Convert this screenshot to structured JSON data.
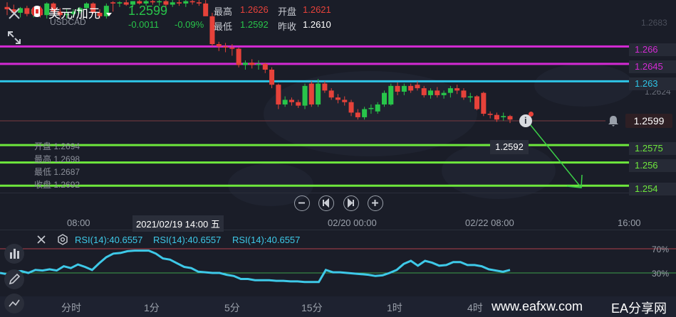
{
  "header": {
    "symbol_name": "美元/加元",
    "symbol_code": "USDCAD",
    "last_price": "1.2599",
    "change": "-0.0011",
    "change_pct": "-0.09%",
    "high_label": "最高",
    "high_value": "1.2626",
    "open_label": "开盘",
    "open_value": "1.2621",
    "low_label": "最低",
    "low_value": "1.2592",
    "prev_close_label": "昨收",
    "prev_close_value": "1.2610"
  },
  "ohlc_box": {
    "open": "开盘 1.2694",
    "high": "最高 1.2698",
    "low": "最低 1.2687",
    "close": "收盘 1.2692"
  },
  "levels": [
    {
      "price": 1.266,
      "label": "1.266",
      "color": "#d42ad4"
    },
    {
      "price": 1.2645,
      "label": "1.2645",
      "color": "#d42ad4"
    },
    {
      "price": 1.263,
      "label": "1.263",
      "color": "#2ec4e6"
    },
    {
      "price": 1.2575,
      "label": "1.2575",
      "color": "#6ee83c"
    },
    {
      "price": 1.256,
      "label": "1.256",
      "color": "#6ee83c"
    },
    {
      "price": 1.254,
      "label": "1.254",
      "color": "#6ee83c"
    }
  ],
  "current_price_label": "1.2599",
  "price_scale_ticks": [
    "1.2683",
    "1.2624"
  ],
  "tooltip_price": "1.2592",
  "time_axis": [
    "08:00",
    "2021/02/19 14:00 五",
    "02/20 00:00",
    "02/22 08:00",
    "16:00"
  ],
  "rsi": {
    "legend": [
      "RSI(14):40.6557",
      "RSI(14):40.6557",
      "RSI(14):40.6557"
    ],
    "upper_label": "70%",
    "lower_label": "30%",
    "values": [
      30,
      28,
      32,
      33,
      30,
      35,
      34,
      36,
      34,
      41,
      38,
      44,
      40,
      35,
      46,
      56,
      62,
      63,
      66,
      67,
      67,
      67,
      62,
      54,
      52,
      46,
      40,
      38,
      32,
      31,
      30,
      30,
      27,
      25,
      20,
      20,
      18,
      18,
      18,
      17,
      17,
      16,
      16,
      15,
      15,
      15,
      35,
      31,
      31,
      30,
      29,
      28,
      27,
      25,
      26,
      30,
      35,
      45,
      50,
      42,
      50,
      47,
      42,
      43,
      48,
      48,
      43,
      43,
      41,
      36,
      34,
      32,
      35
    ]
  },
  "periods": [
    "分时",
    "1分",
    "5分",
    "15分",
    "1时",
    "4时"
  ],
  "watermark": "www.eafxw.com",
  "brand": "EA分享网",
  "colors": {
    "up": "#28c44a",
    "down": "#e6423a",
    "rsi": "#3ec9e8",
    "background": "#1a1d28"
  },
  "icons": [
    "close-icon",
    "canada-flag-icon",
    "dropdown-icon",
    "expand-icon",
    "bell-icon",
    "info-icon",
    "zoom-out-icon",
    "prev-icon",
    "next-icon",
    "zoom-in-icon",
    "settings-icon",
    "indicators-icon",
    "draw-icon",
    "chart-type-icon"
  ],
  "chart_data": {
    "type": "candlestick",
    "candles": [
      {
        "o": 1.2694,
        "h": 1.2698,
        "l": 1.2687,
        "c": 1.2692
      },
      {
        "o": 1.2692,
        "h": 1.2696,
        "l": 1.2687,
        "c": 1.2689
      },
      {
        "o": 1.2689,
        "h": 1.2694,
        "l": 1.2685,
        "c": 1.2693
      },
      {
        "o": 1.2693,
        "h": 1.2695,
        "l": 1.2686,
        "c": 1.2688
      },
      {
        "o": 1.2688,
        "h": 1.2694,
        "l": 1.2685,
        "c": 1.2692
      },
      {
        "o": 1.2692,
        "h": 1.2695,
        "l": 1.2685,
        "c": 1.2687
      },
      {
        "o": 1.2687,
        "h": 1.2698,
        "l": 1.2684,
        "c": 1.2697
      },
      {
        "o": 1.2697,
        "h": 1.2698,
        "l": 1.2688,
        "c": 1.269
      },
      {
        "o": 1.269,
        "h": 1.2693,
        "l": 1.2685,
        "c": 1.2687
      },
      {
        "o": 1.2687,
        "h": 1.2692,
        "l": 1.2684,
        "c": 1.2688
      },
      {
        "o": 1.2688,
        "h": 1.2692,
        "l": 1.2685,
        "c": 1.269
      },
      {
        "o": 1.269,
        "h": 1.2694,
        "l": 1.2688,
        "c": 1.2693
      },
      {
        "o": 1.2693,
        "h": 1.2698,
        "l": 1.2687,
        "c": 1.2697
      },
      {
        "o": 1.2697,
        "h": 1.2698,
        "l": 1.2688,
        "c": 1.2689
      },
      {
        "o": 1.2689,
        "h": 1.2692,
        "l": 1.2684,
        "c": 1.2686
      },
      {
        "o": 1.2686,
        "h": 1.2697,
        "l": 1.2684,
        "c": 1.2695
      },
      {
        "o": 1.2698,
        "h": 1.2699,
        "l": 1.269,
        "c": 1.2697
      },
      {
        "o": 1.2697,
        "h": 1.2699,
        "l": 1.2694,
        "c": 1.2698
      },
      {
        "o": 1.2698,
        "h": 1.27,
        "l": 1.2695,
        "c": 1.2696
      },
      {
        "o": 1.2696,
        "h": 1.2699,
        "l": 1.2694,
        "c": 1.2699
      },
      {
        "o": 1.2699,
        "h": 1.27,
        "l": 1.2696,
        "c": 1.2697
      },
      {
        "o": 1.2697,
        "h": 1.27,
        "l": 1.2695,
        "c": 1.2699
      },
      {
        "o": 1.2699,
        "h": 1.27,
        "l": 1.2696,
        "c": 1.2698
      },
      {
        "o": 1.2698,
        "h": 1.27,
        "l": 1.2695,
        "c": 1.2699
      },
      {
        "o": 1.2699,
        "h": 1.27,
        "l": 1.2694,
        "c": 1.2696
      },
      {
        "o": 1.2696,
        "h": 1.27,
        "l": 1.2694,
        "c": 1.2698
      },
      {
        "o": 1.2698,
        "h": 1.27,
        "l": 1.2695,
        "c": 1.2697
      },
      {
        "o": 1.2697,
        "h": 1.27,
        "l": 1.2694,
        "c": 1.2699
      },
      {
        "o": 1.2699,
        "h": 1.27,
        "l": 1.2696,
        "c": 1.2698
      },
      {
        "o": 1.2698,
        "h": 1.27,
        "l": 1.2695,
        "c": 1.2697
      },
      {
        "o": 1.2697,
        "h": 1.27,
        "l": 1.2693,
        "c": 1.2686
      },
      {
        "o": 1.2686,
        "h": 1.2689,
        "l": 1.266,
        "c": 1.2662
      },
      {
        "o": 1.2662,
        "h": 1.2664,
        "l": 1.2656,
        "c": 1.266
      },
      {
        "o": 1.266,
        "h": 1.2663,
        "l": 1.2655,
        "c": 1.2659
      },
      {
        "o": 1.2659,
        "h": 1.2662,
        "l": 1.2652,
        "c": 1.2658
      },
      {
        "o": 1.2658,
        "h": 1.2659,
        "l": 1.2642,
        "c": 1.2644
      },
      {
        "o": 1.2644,
        "h": 1.2648,
        "l": 1.264,
        "c": 1.2646
      },
      {
        "o": 1.2646,
        "h": 1.2649,
        "l": 1.2641,
        "c": 1.2644
      },
      {
        "o": 1.2644,
        "h": 1.2648,
        "l": 1.264,
        "c": 1.2645
      },
      {
        "o": 1.2645,
        "h": 1.2646,
        "l": 1.2637,
        "c": 1.264
      },
      {
        "o": 1.264,
        "h": 1.2642,
        "l": 1.2624,
        "c": 1.2627
      },
      {
        "o": 1.2627,
        "h": 1.2628,
        "l": 1.2606,
        "c": 1.261
      },
      {
        "o": 1.261,
        "h": 1.2617,
        "l": 1.2608,
        "c": 1.2614
      },
      {
        "o": 1.2614,
        "h": 1.2616,
        "l": 1.2609,
        "c": 1.2612
      },
      {
        "o": 1.2612,
        "h": 1.2614,
        "l": 1.2607,
        "c": 1.2609
      },
      {
        "o": 1.2609,
        "h": 1.2628,
        "l": 1.2606,
        "c": 1.2626
      },
      {
        "o": 1.2628,
        "h": 1.263,
        "l": 1.2608,
        "c": 1.261
      },
      {
        "o": 1.261,
        "h": 1.2632,
        "l": 1.2608,
        "c": 1.2628
      },
      {
        "o": 1.2628,
        "h": 1.263,
        "l": 1.262,
        "c": 1.2622
      },
      {
        "o": 1.2622,
        "h": 1.2624,
        "l": 1.2614,
        "c": 1.2616
      },
      {
        "o": 1.2616,
        "h": 1.2619,
        "l": 1.2611,
        "c": 1.2614
      },
      {
        "o": 1.2614,
        "h": 1.2617,
        "l": 1.2609,
        "c": 1.2612
      },
      {
        "o": 1.2612,
        "h": 1.2614,
        "l": 1.26,
        "c": 1.2603
      },
      {
        "o": 1.2603,
        "h": 1.2606,
        "l": 1.2597,
        "c": 1.2599
      },
      {
        "o": 1.2599,
        "h": 1.2608,
        "l": 1.2597,
        "c": 1.2606
      },
      {
        "o": 1.2606,
        "h": 1.261,
        "l": 1.2602,
        "c": 1.2607
      },
      {
        "o": 1.2604,
        "h": 1.2612,
        "l": 1.2602,
        "c": 1.261
      },
      {
        "o": 1.261,
        "h": 1.2622,
        "l": 1.2608,
        "c": 1.262
      },
      {
        "o": 1.261,
        "h": 1.2628,
        "l": 1.2609,
        "c": 1.2626
      },
      {
        "o": 1.2626,
        "h": 1.2629,
        "l": 1.2618,
        "c": 1.2621
      },
      {
        "o": 1.2621,
        "h": 1.2628,
        "l": 1.2618,
        "c": 1.2626
      },
      {
        "o": 1.2626,
        "h": 1.2628,
        "l": 1.262,
        "c": 1.2622
      },
      {
        "o": 1.2627,
        "h": 1.263,
        "l": 1.2622,
        "c": 1.2624
      },
      {
        "o": 1.2624,
        "h": 1.2626,
        "l": 1.2616,
        "c": 1.2618
      },
      {
        "o": 1.2618,
        "h": 1.2624,
        "l": 1.2615,
        "c": 1.2622
      },
      {
        "o": 1.2622,
        "h": 1.2625,
        "l": 1.2616,
        "c": 1.2618
      },
      {
        "o": 1.2618,
        "h": 1.2622,
        "l": 1.2615,
        "c": 1.262
      },
      {
        "o": 1.262,
        "h": 1.2626,
        "l": 1.2616,
        "c": 1.2624
      },
      {
        "o": 1.2624,
        "h": 1.2627,
        "l": 1.2619,
        "c": 1.2622
      },
      {
        "o": 1.2622,
        "h": 1.2624,
        "l": 1.2614,
        "c": 1.2616
      },
      {
        "o": 1.2616,
        "h": 1.262,
        "l": 1.2612,
        "c": 1.2617
      },
      {
        "o": 1.2617,
        "h": 1.2618,
        "l": 1.2605,
        "c": 1.2606
      },
      {
        "o": 1.262,
        "h": 1.2621,
        "l": 1.26,
        "c": 1.2602
      },
      {
        "o": 1.2602,
        "h": 1.2604,
        "l": 1.2598,
        "c": 1.2601
      },
      {
        "o": 1.2601,
        "h": 1.2603,
        "l": 1.2595,
        "c": 1.2597
      },
      {
        "o": 1.2599,
        "h": 1.2603,
        "l": 1.2596,
        "c": 1.26
      },
      {
        "o": 1.26,
        "h": 1.2601,
        "l": 1.2594,
        "c": 1.2597
      }
    ]
  }
}
